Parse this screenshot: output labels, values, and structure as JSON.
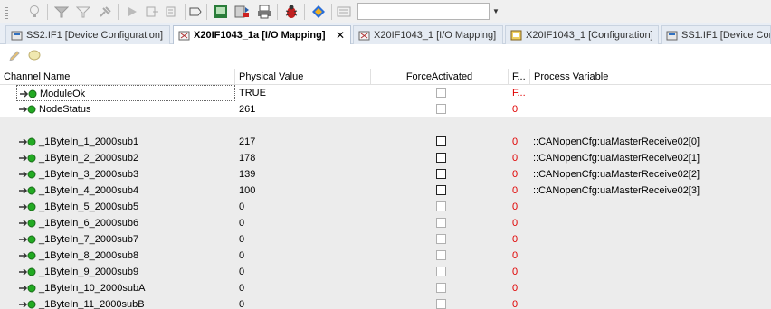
{
  "toolbar": {
    "icons": [
      "grip-icon",
      "lightbulb-icon",
      "filter-icon",
      "filter-clear-icon",
      "pin-icon",
      "play-icon",
      "step-over-icon",
      "step-into-icon",
      "tag-icon",
      "monitor-icon",
      "transfer-icon",
      "print-icon",
      "bug-icon",
      "diamond-icon",
      "list-icon"
    ],
    "combo_value": ""
  },
  "tabs": [
    {
      "label": "SS2.IF1 [Device Configuration]",
      "active": false
    },
    {
      "label": "X20IF1043_1a [I/O Mapping]",
      "active": true,
      "close": "✕"
    },
    {
      "label": "X20IF1043_1 [I/O Mapping]",
      "active": false
    },
    {
      "label": "X20IF1043_1 [Configuration]",
      "active": false
    },
    {
      "label": "SS1.IF1 [Device Configuration]",
      "active": false
    }
  ],
  "grid": {
    "columns": {
      "channel": "Channel Name",
      "physical": "Physical Value",
      "force": "ForceActivated",
      "f": "F...",
      "pv": "Process Variable"
    },
    "rows": [
      {
        "name": "ModuleOk",
        "phys": "TRUE",
        "f": "F...",
        "pv": "",
        "chk": "light"
      },
      {
        "name": "NodeStatus",
        "phys": "261",
        "f": "0",
        "pv": "",
        "chk": "light"
      },
      {
        "blank": true
      },
      {
        "name": "_1ByteIn_1_2000sub1",
        "phys": "217",
        "f": "0",
        "pv": "::CANopenCfg:uaMasterReceive02[0]",
        "chk": "dark"
      },
      {
        "name": "_1ByteIn_2_2000sub2",
        "phys": "178",
        "f": "0",
        "pv": "::CANopenCfg:uaMasterReceive02[1]",
        "chk": "dark"
      },
      {
        "name": "_1ByteIn_3_2000sub3",
        "phys": "139",
        "f": "0",
        "pv": "::CANopenCfg:uaMasterReceive02[2]",
        "chk": "dark"
      },
      {
        "name": "_1ByteIn_4_2000sub4",
        "phys": "100",
        "f": "0",
        "pv": "::CANopenCfg:uaMasterReceive02[3]",
        "chk": "dark"
      },
      {
        "name": "_1ByteIn_5_2000sub5",
        "phys": "0",
        "f": "0",
        "pv": "",
        "chk": "light"
      },
      {
        "name": "_1ByteIn_6_2000sub6",
        "phys": "0",
        "f": "0",
        "pv": "",
        "chk": "light"
      },
      {
        "name": "_1ByteIn_7_2000sub7",
        "phys": "0",
        "f": "0",
        "pv": "",
        "chk": "light"
      },
      {
        "name": "_1ByteIn_8_2000sub8",
        "phys": "0",
        "f": "0",
        "pv": "",
        "chk": "light"
      },
      {
        "name": "_1ByteIn_9_2000sub9",
        "phys": "0",
        "f": "0",
        "pv": "",
        "chk": "light"
      },
      {
        "name": "_1ByteIn_10_2000subA",
        "phys": "0",
        "f": "0",
        "pv": "",
        "chk": "light"
      },
      {
        "name": "_1ByteIn_11_2000subB",
        "phys": "0",
        "f": "0",
        "pv": "",
        "chk": "light"
      }
    ]
  },
  "colors": {
    "green_led": "#22aa22",
    "force_red": "#e00000",
    "row_gray": "#ececec"
  }
}
